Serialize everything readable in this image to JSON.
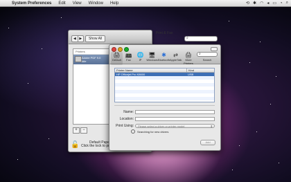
{
  "menubar": {
    "apple": "",
    "items": [
      "System Preferences",
      "Edit",
      "View",
      "Window",
      "Help"
    ],
    "right_icons": [
      "time-machine-icon",
      "bluetooth-icon",
      "wifi-icon",
      "volume-icon",
      "battery-icon",
      "clock-icon",
      "spotlight-icon"
    ],
    "right_glyphs": [
      "⟲",
      "✱",
      "◠",
      "◂",
      "▭",
      "◔",
      "⌕"
    ]
  },
  "system_preferences": {
    "nav_back": "◀",
    "nav_forward": "▶",
    "show_all_label": "Show All",
    "printers_header": "Printers",
    "selected_printer": "Adobe PDF 9.0\nIdle",
    "add_button": "+",
    "remove_button": "−",
    "default_paper_label": "Default Paper",
    "lock_text": "Click the lock to prev"
  },
  "print_fax_window": {
    "title": "Print & Fax",
    "toolbar": [
      {
        "label": "Default",
        "icon": "🖨"
      },
      {
        "label": "Fax",
        "icon": "📠"
      },
      {
        "label": "IP",
        "icon": "🌐"
      },
      {
        "label": "Windows",
        "icon": "🖥"
      },
      {
        "label": "Bluetooth",
        "icon": "✱"
      },
      {
        "label": "AppleTalk",
        "icon": "⇄"
      },
      {
        "label": "More Printers",
        "icon": "🖨"
      }
    ],
    "search_label": "Search",
    "table": {
      "columns": [
        "Printer Name",
        "Kind"
      ],
      "rows": [
        {
          "name": "HP Officejet Pro K8600",
          "kind": "USB"
        }
      ]
    },
    "form": {
      "name_label": "Name:",
      "name_value": "",
      "location_label": "Location:",
      "location_value": "",
      "print_using_label": "Print Using:",
      "print_using_value": "Please select a driver or printer model",
      "searching_text": "Searching for new drivers"
    },
    "add_button": "Add"
  },
  "colors": {
    "selection_blue": "#3d6fb5",
    "close": "#e0443e",
    "minimize": "#dea123",
    "zoom": "#1aab29"
  }
}
